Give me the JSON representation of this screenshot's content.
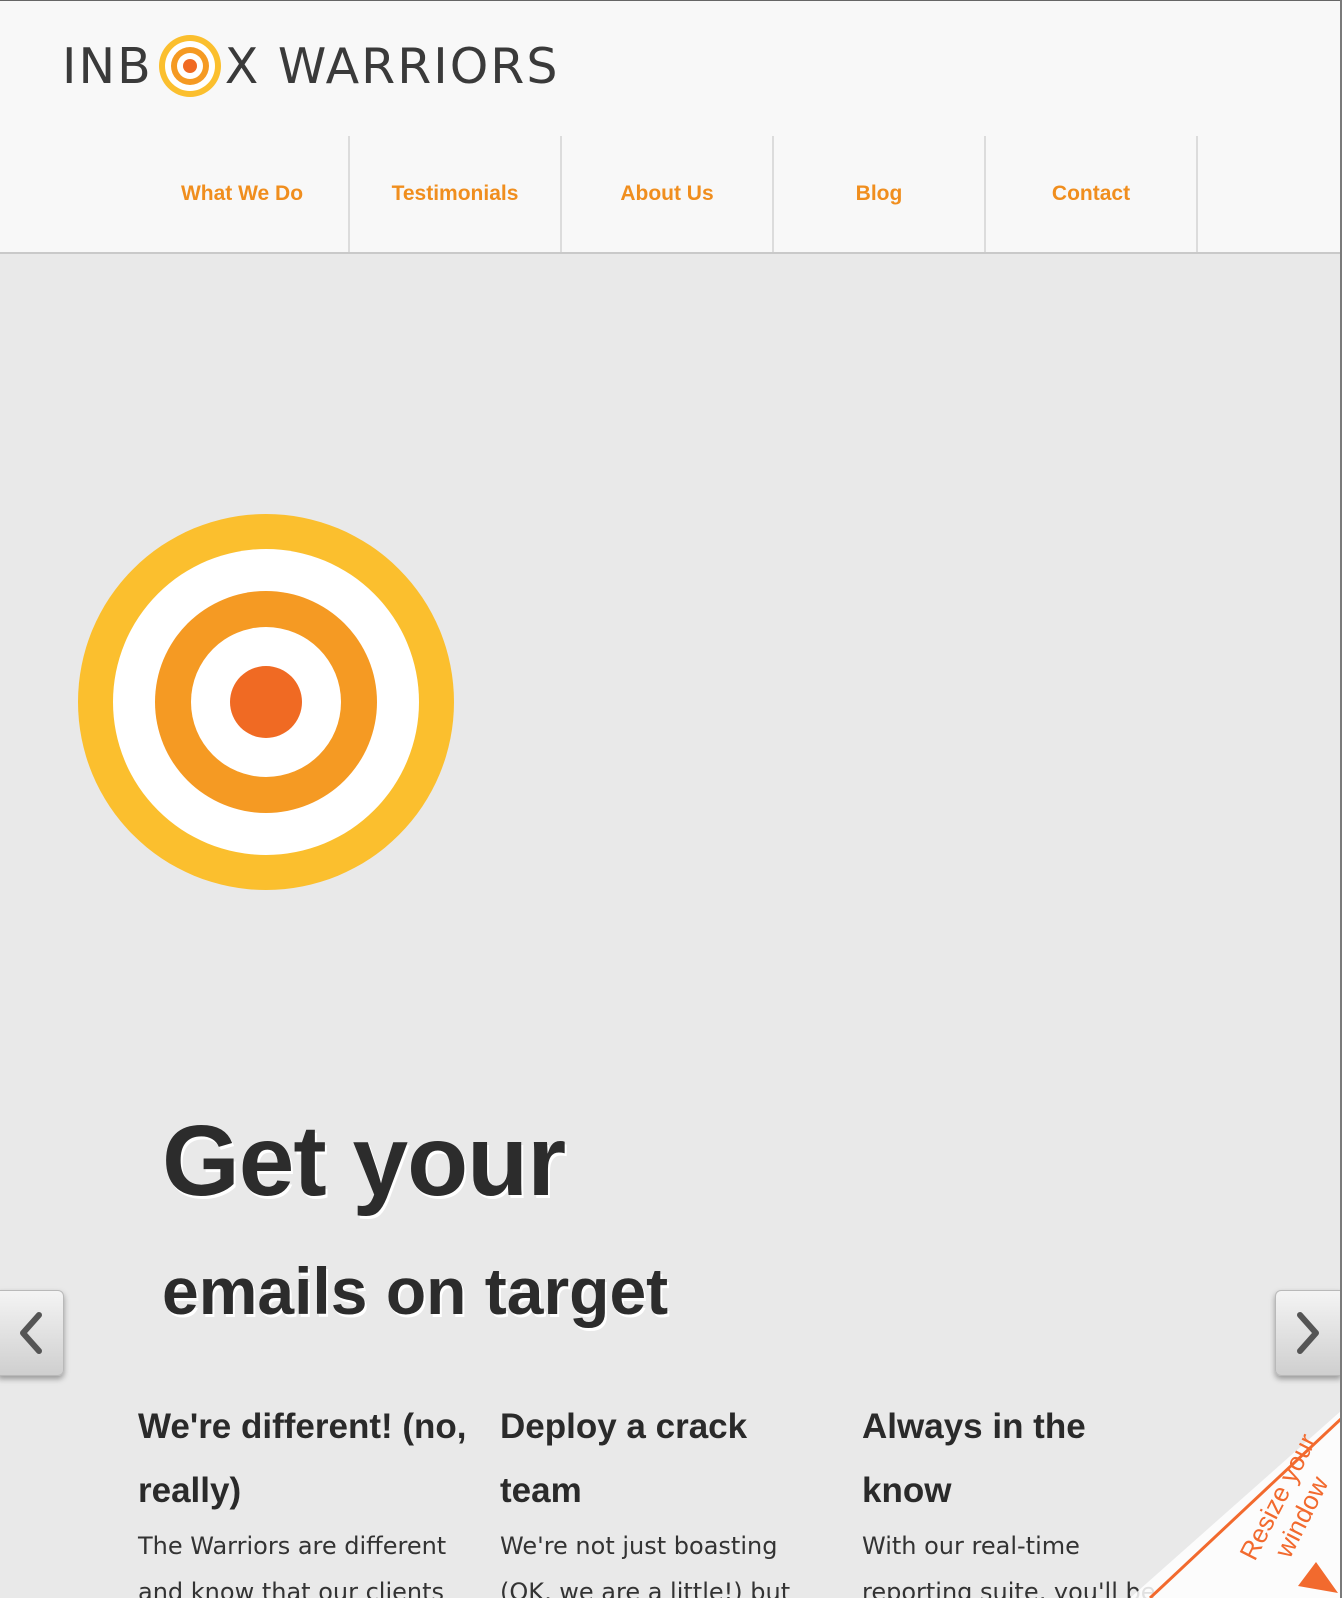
{
  "header": {
    "logo_text_before": "INB",
    "logo_text_after": "X WARRIORS"
  },
  "nav": {
    "items": [
      {
        "label": "What We Do"
      },
      {
        "label": "Testimonials"
      },
      {
        "label": "About Us"
      },
      {
        "label": "Blog"
      },
      {
        "label": "Contact"
      }
    ]
  },
  "hero": {
    "title_line1": "Get your",
    "title_line2": "emails on target"
  },
  "features": [
    {
      "heading": "We're different! (no, really)",
      "text": "The Warriors are different and know that our clients"
    },
    {
      "heading": "Deploy a crack team",
      "text": "We're not just boasting (OK, we are a little!) but"
    },
    {
      "heading": "Always in the know",
      "text": "With our real-time reporting suite, you'll be able to keep up-to-date o"
    }
  ],
  "resize_banner": {
    "line1": "Resize your",
    "line2": "window"
  },
  "colors": {
    "accent_orange": "#f08e1e",
    "target_outer": "#fbbf2e",
    "target_mid": "#f59a23",
    "target_center": "#f06a23"
  },
  "icons": {
    "prev": "chevron-left-icon",
    "next": "chevron-right-icon"
  }
}
